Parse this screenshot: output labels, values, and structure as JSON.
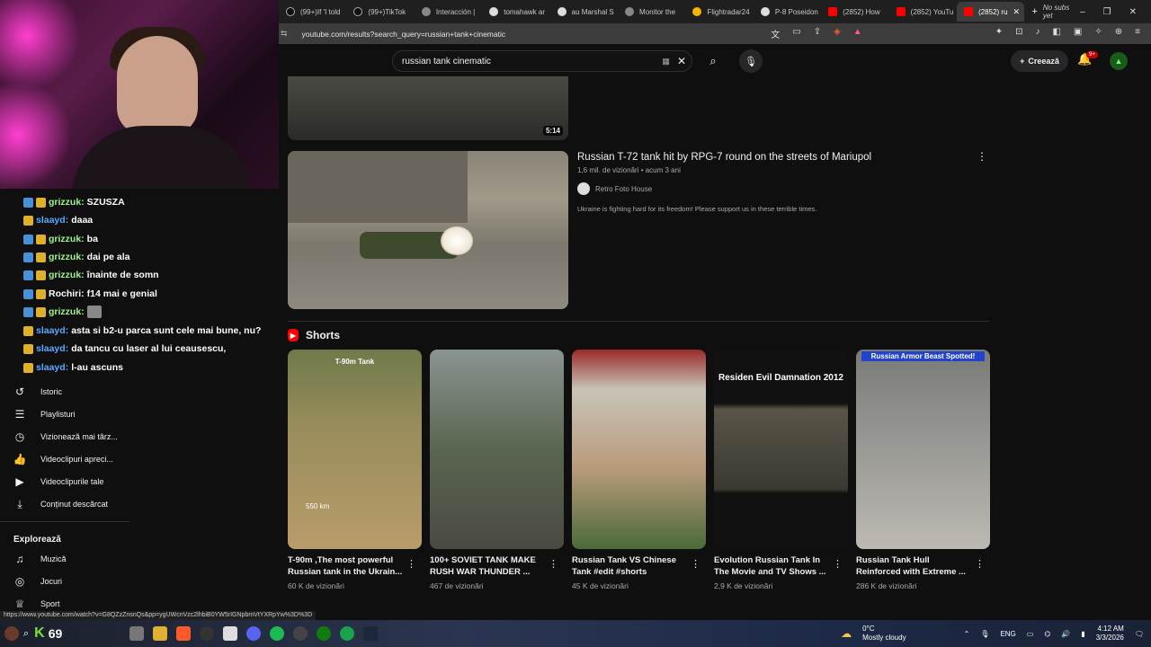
{
  "browser": {
    "tabs": [
      {
        "label": "(99+)If 'I told"
      },
      {
        "label": "(99+)TikTok"
      },
      {
        "label": "Interacción |"
      },
      {
        "label": "tomahawk ar"
      },
      {
        "label": "au Marshal S"
      },
      {
        "label": "Monitor the"
      },
      {
        "label": "Flightradar24"
      },
      {
        "label": "P-8 Poseidon"
      },
      {
        "label": "(2852) How"
      },
      {
        "label": "(2852) YouTu"
      },
      {
        "label": "(2852) ru"
      }
    ],
    "new_tab": "+",
    "profile_label": "No subs yet",
    "url": "youtube.com/results?search_query=russian+tank+cinematic"
  },
  "youtube": {
    "search_value": "russian tank cinematic",
    "create_label": "Creează",
    "notification_count": "9+",
    "top_video": {
      "duration": "5:14"
    },
    "result": {
      "title": "Russian T-72 tank hit by RPG-7 round on the streets of Mariupol",
      "meta": "1,6 mil. de vizionări • acum 3 ani",
      "channel": "Retro Foto House",
      "description": "Ukraine is fighting hard for its freedom! Please support us in these terrible times."
    },
    "shorts_heading": "Shorts",
    "shorts": [
      {
        "title": "T-90m ,The most powerful Russian tank in the Ukrain...",
        "views": "60 K de vizionări",
        "caption": "T-90m Tank",
        "sub": "550 km"
      },
      {
        "title": "100+ SOVIET TANK MAKE RUSH WAR THUNDER ...",
        "views": "467 de vizionări",
        "caption": "",
        "sub": ""
      },
      {
        "title": "Russian Tank VS Chinese Tank #edit #shorts",
        "views": "45 K de vizionări",
        "caption": "",
        "sub": ""
      },
      {
        "title": "Evolution Russian Tank In The Movie and TV Shows ...",
        "views": "2,9 K de vizionări",
        "caption": "Residen Evil Damnation 2012",
        "sub": ""
      },
      {
        "title": "Russian Tank Hull Reinforced with Extreme ...",
        "views": "286 K de vizionări",
        "caption": "Russian Armor Beast Spotted!",
        "sub": ""
      }
    ]
  },
  "chat": [
    {
      "user": "grizzuk:",
      "msg": "SZUSZA"
    },
    {
      "user": "slaayd:",
      "msg": "daaa"
    },
    {
      "user": "grizzuk:",
      "msg": "ba"
    },
    {
      "user": "grizzuk:",
      "msg": "dai pe ala"
    },
    {
      "user": "grizzuk:",
      "msg": "înainte de somn"
    },
    {
      "user": "Rochiri:",
      "msg": "f14 mai e genial"
    },
    {
      "user": "grizzuk:",
      "msg": ""
    },
    {
      "user": "slaayd:",
      "msg": "asta si b2-u parca sunt cele mai bune, nu?"
    },
    {
      "user": "slaayd:",
      "msg": "da tancu cu laser al lui ceausescu,"
    },
    {
      "user": "slaayd:",
      "msg": "l-au ascuns"
    }
  ],
  "sidebar": {
    "items": [
      {
        "label": "Istoric",
        "icon": "history-icon"
      },
      {
        "label": "Playlisturi",
        "icon": "playlist-icon"
      },
      {
        "label": "Vizionează mai târz...",
        "icon": "clock-icon"
      },
      {
        "label": "Videoclipuri apreci...",
        "icon": "like-icon"
      },
      {
        "label": "Videoclipurile tale",
        "icon": "video-icon"
      },
      {
        "label": "Conținut descărcat",
        "icon": "download-icon"
      }
    ],
    "explore_heading": "Explorează",
    "explore_items": [
      {
        "label": "Muzică",
        "icon": "music-icon"
      },
      {
        "label": "Jocuri",
        "icon": "gamepad-icon"
      },
      {
        "label": "Sport",
        "icon": "trophy-icon"
      }
    ]
  },
  "status_url": "https://www.youtube.com/watch?v=G8QZzZnsnQs&pp=ygUWcnVzc2lhbiB0YW5rIGNpbmVtYXRpYw%3D%3D",
  "taskbar": {
    "score": "69",
    "weather_temp": "0°C",
    "weather_desc": "Mostly cloudy",
    "lang": "ENG",
    "time": "4:12 AM",
    "date": "3/3/2026"
  },
  "colors": {
    "accent": "#ff0000",
    "background": "#0f0f0f",
    "chat_user": "#9ef58a"
  }
}
